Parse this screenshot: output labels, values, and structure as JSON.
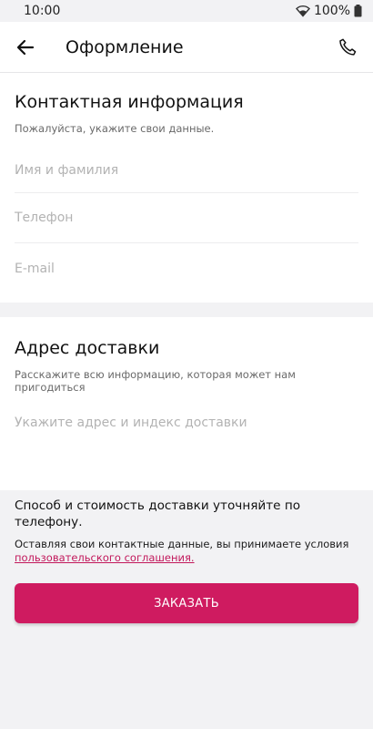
{
  "status": {
    "time": "10:00",
    "battery": "100%"
  },
  "appbar": {
    "title": "Оформление"
  },
  "contact": {
    "title": "Контактная информация",
    "subtitle": "Пожалуйста, укажите свои данные.",
    "name_placeholder": "Имя и фамилия",
    "phone_placeholder": "Телефон",
    "email_placeholder": "E-mail"
  },
  "delivery": {
    "title": "Адрес доставки",
    "subtitle": "Расскажите всю информацию, которая может нам пригодиться",
    "address_placeholder": "Укажите адрес и индекс доставки"
  },
  "footer": {
    "note": "Способ и стоимость доставки уточняйте по телефону.",
    "terms_text": "Оставляя свои контактные данные, вы принимаете условия",
    "terms_link": "пользовательского соглашения.",
    "order_label": "ЗАКАЗАТЬ"
  },
  "colors": {
    "accent": "#cf1b60",
    "link": "#c2185b",
    "background": "#f2f2f4"
  }
}
